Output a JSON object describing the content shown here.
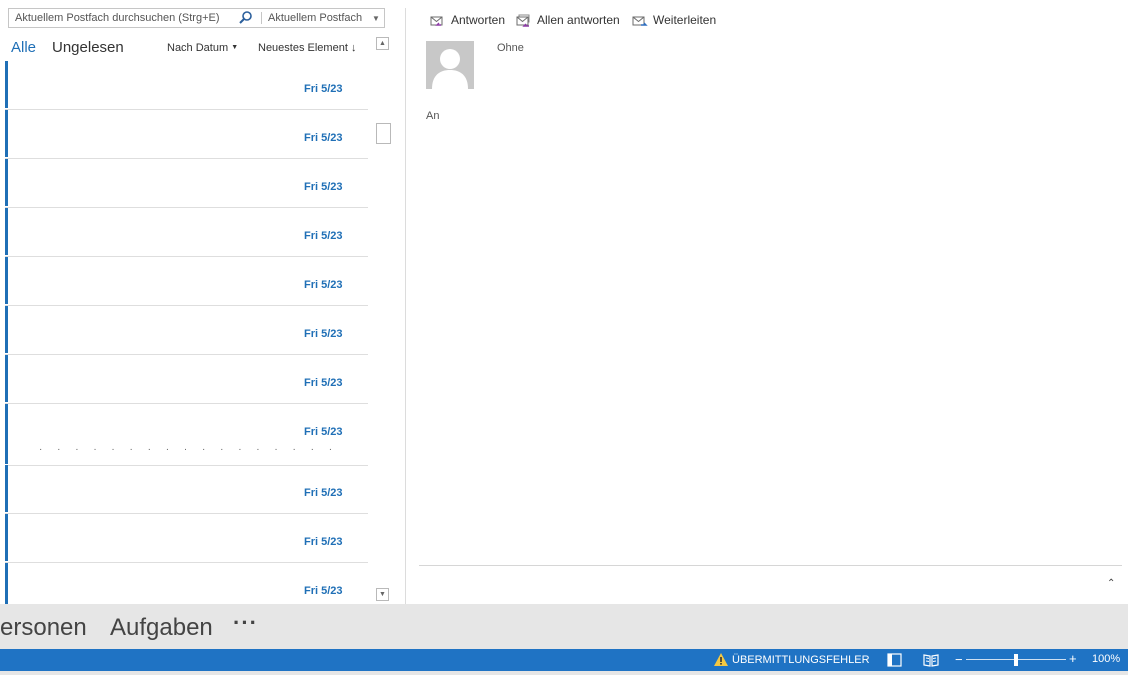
{
  "search": {
    "placeholder": "Aktuellem Postfach durchsuchen (Strg+E)",
    "scope": "Aktuellem Postfach"
  },
  "filters": {
    "all": "Alle",
    "unread": "Ungelesen",
    "sort_by": "Nach Datum",
    "sort_order": "Neuestes Element"
  },
  "messages": [
    {
      "date": "Fri 5/23"
    },
    {
      "date": "Fri 5/23"
    },
    {
      "date": "Fri 5/23"
    },
    {
      "date": "Fri 5/23"
    },
    {
      "date": "Fri 5/23"
    },
    {
      "date": "Fri 5/23"
    },
    {
      "date": "Fri 5/23"
    },
    {
      "date": "Fri 5/23",
      "preview": "· · · · · · · · · · · · · · · · ·"
    },
    {
      "date": "Fri 5/23"
    },
    {
      "date": "Fri 5/23"
    },
    {
      "date": "Fri 5/23"
    }
  ],
  "reading_pane": {
    "actions": {
      "reply": "Antworten",
      "reply_all": "Allen antworten",
      "forward": "Weiterleiten"
    },
    "sender": "Ohne",
    "to_label": "An"
  },
  "nav": {
    "people": "ersonen",
    "tasks": "Aufgaben",
    "more": "···"
  },
  "status": {
    "warning": "ÜBERMITTLUNGSFEHLER",
    "zoom": "100%",
    "zoom_level": 0.5,
    "minus": "−",
    "plus": "+"
  },
  "colors": {
    "accent": "#1f6fb6",
    "status_bar": "#1f73c4"
  }
}
